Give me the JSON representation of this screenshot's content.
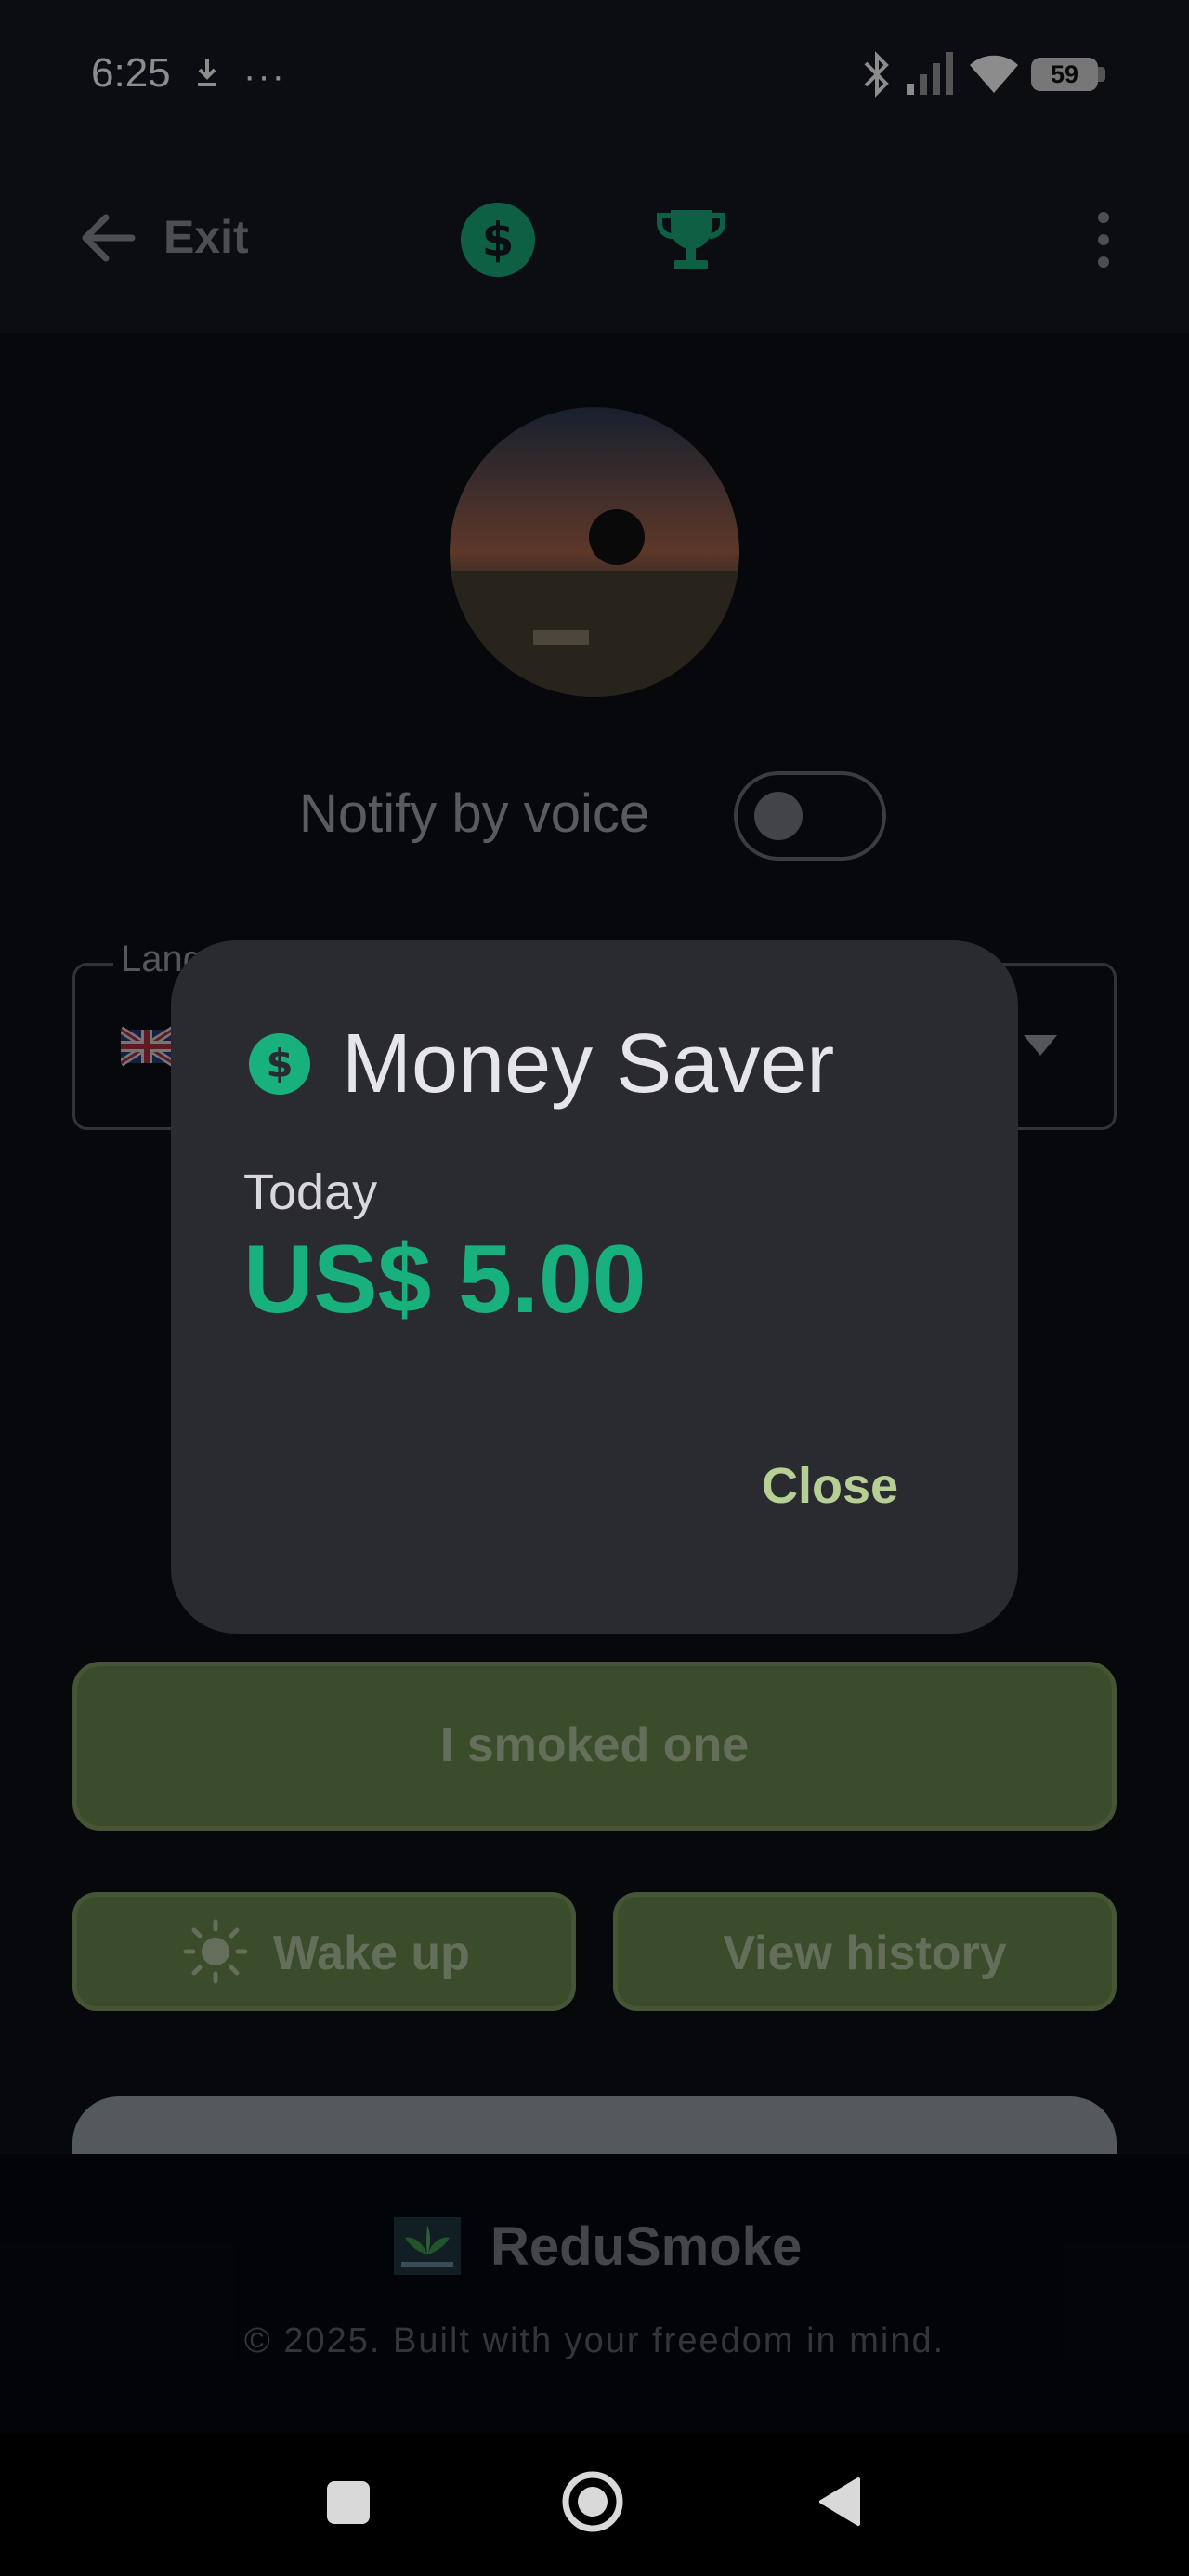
{
  "status_bar": {
    "time": "6:25",
    "more": "···",
    "battery_level": "59"
  },
  "app_bar": {
    "exit_label": "Exit",
    "accent_color": "#18b07c",
    "icons": [
      "back-arrow-icon",
      "dollar-icon",
      "trophy-icon",
      "more-vert-icon"
    ]
  },
  "profile": {
    "notify_label": "Notify by voice",
    "notify_enabled": false
  },
  "language": {
    "legend": "Lang",
    "flag": "🇬🇧"
  },
  "actions": {
    "smoked_label": "I smoked one",
    "wake_label": "Wake up",
    "history_label": "View history"
  },
  "footer": {
    "brand": "ReduSmoke",
    "copyright": "© 2025. Built with your freedom in mind."
  },
  "dialog": {
    "title": "Money Saver",
    "today_label": "Today",
    "amount": "US$ 5.00",
    "close_label": "Close"
  }
}
